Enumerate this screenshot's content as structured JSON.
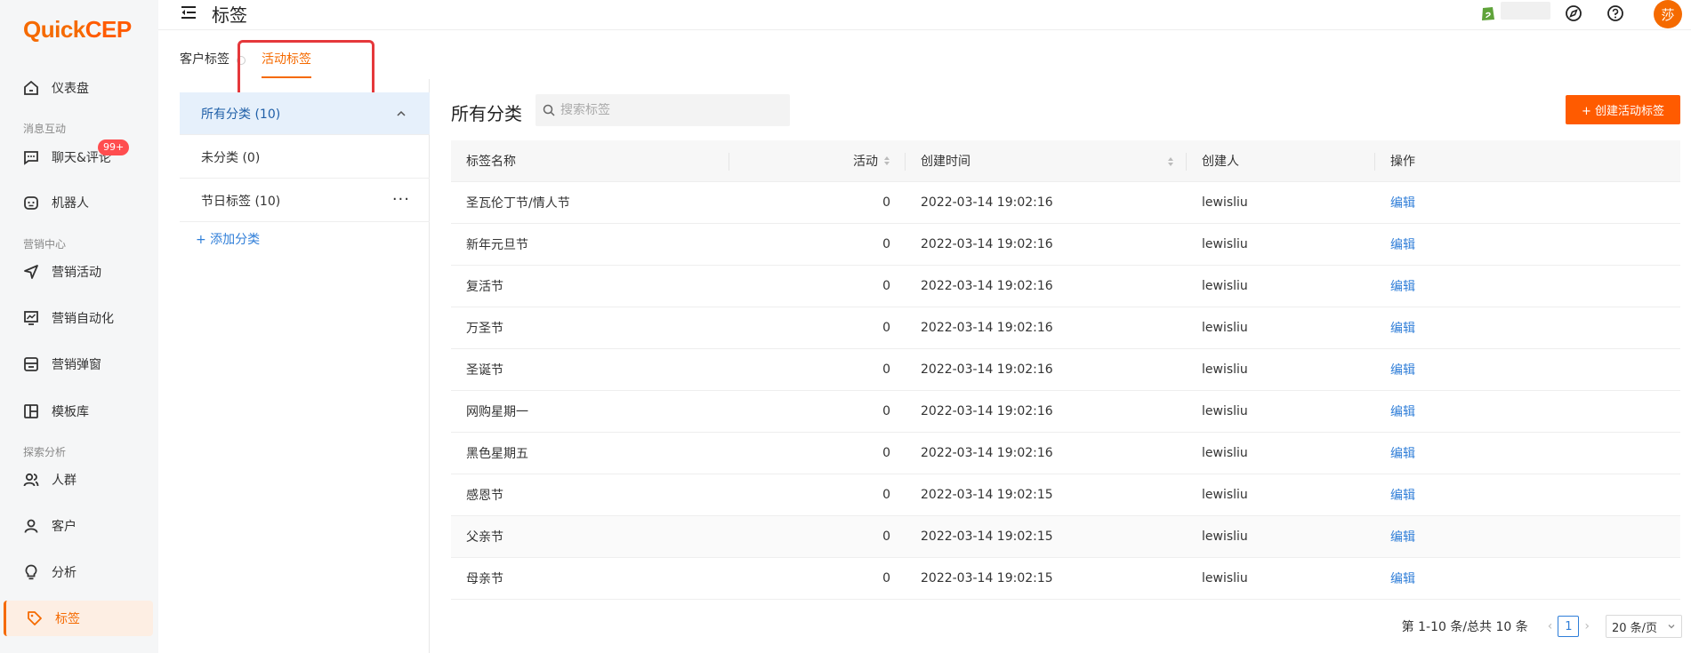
{
  "brand": {
    "logo_q": "Q",
    "logo_uick": "uick",
    "logo_cep": "CEP"
  },
  "sidebar": {
    "groups": {
      "messaging": "消息互动",
      "marketing": "营销中心",
      "analytics": "探索分析"
    },
    "items": [
      {
        "label": "仪表盘",
        "icon": "dashboard-icon"
      },
      {
        "label": "聊天&评论",
        "icon": "chat-icon",
        "badge": "99+"
      },
      {
        "label": "机器人",
        "icon": "robot-icon"
      },
      {
        "label": "营销活动",
        "icon": "send-icon"
      },
      {
        "label": "营销自动化",
        "icon": "automation-icon"
      },
      {
        "label": "营销弹窗",
        "icon": "popup-icon"
      },
      {
        "label": "模板库",
        "icon": "template-icon"
      },
      {
        "label": "人群",
        "icon": "audience-icon"
      },
      {
        "label": "客户",
        "icon": "customer-icon"
      },
      {
        "label": "分析",
        "icon": "bulb-icon"
      },
      {
        "label": "标签",
        "icon": "tag-icon",
        "active": true
      }
    ]
  },
  "header": {
    "title": "标签",
    "avatar_text": "莎"
  },
  "tabs": {
    "customer": "客户标签",
    "campaign": "活动标签",
    "active": "campaign"
  },
  "categories": {
    "items": [
      {
        "label": "所有分类 (10)",
        "active": true
      },
      {
        "label": "未分类 (0)"
      },
      {
        "label": "节日标签 (10)",
        "more": "···"
      }
    ],
    "add_label": "+ 添加分类"
  },
  "main": {
    "section_title": "所有分类",
    "search_placeholder": "搜索标签",
    "create_button": "+ 创建活动标签"
  },
  "table": {
    "columns": [
      "标签名称",
      "活动",
      "创建时间",
      "创建人",
      "操作"
    ],
    "rows": [
      {
        "name": "圣瓦伦丁节/情人节",
        "count": "0",
        "created": "2022-03-14 19:02:16",
        "creator": "lewisliu",
        "action": "编辑"
      },
      {
        "name": "新年元旦节",
        "count": "0",
        "created": "2022-03-14 19:02:16",
        "creator": "lewisliu",
        "action": "编辑"
      },
      {
        "name": "复活节",
        "count": "0",
        "created": "2022-03-14 19:02:16",
        "creator": "lewisliu",
        "action": "编辑"
      },
      {
        "name": "万圣节",
        "count": "0",
        "created": "2022-03-14 19:02:16",
        "creator": "lewisliu",
        "action": "编辑"
      },
      {
        "name": "圣诞节",
        "count": "0",
        "created": "2022-03-14 19:02:16",
        "creator": "lewisliu",
        "action": "编辑"
      },
      {
        "name": "网购星期一",
        "count": "0",
        "created": "2022-03-14 19:02:16",
        "creator": "lewisliu",
        "action": "编辑"
      },
      {
        "name": "黑色星期五",
        "count": "0",
        "created": "2022-03-14 19:02:16",
        "creator": "lewisliu",
        "action": "编辑"
      },
      {
        "name": "感恩节",
        "count": "0",
        "created": "2022-03-14 19:02:15",
        "creator": "lewisliu",
        "action": "编辑"
      },
      {
        "name": "父亲节",
        "count": "0",
        "created": "2022-03-14 19:02:15",
        "creator": "lewisliu",
        "action": "编辑"
      },
      {
        "name": "母亲节",
        "count": "0",
        "created": "2022-03-14 19:02:15",
        "creator": "lewisliu",
        "action": "编辑"
      }
    ]
  },
  "pagination": {
    "total_text": "第 1-10 条/总共 10 条",
    "current_page": "1",
    "page_size": "20 条/页"
  },
  "colors": {
    "accent": "#f56a00",
    "primary_button": "#ff5b00",
    "link": "#2f7ed8",
    "highlight_box": "#e5383b"
  }
}
